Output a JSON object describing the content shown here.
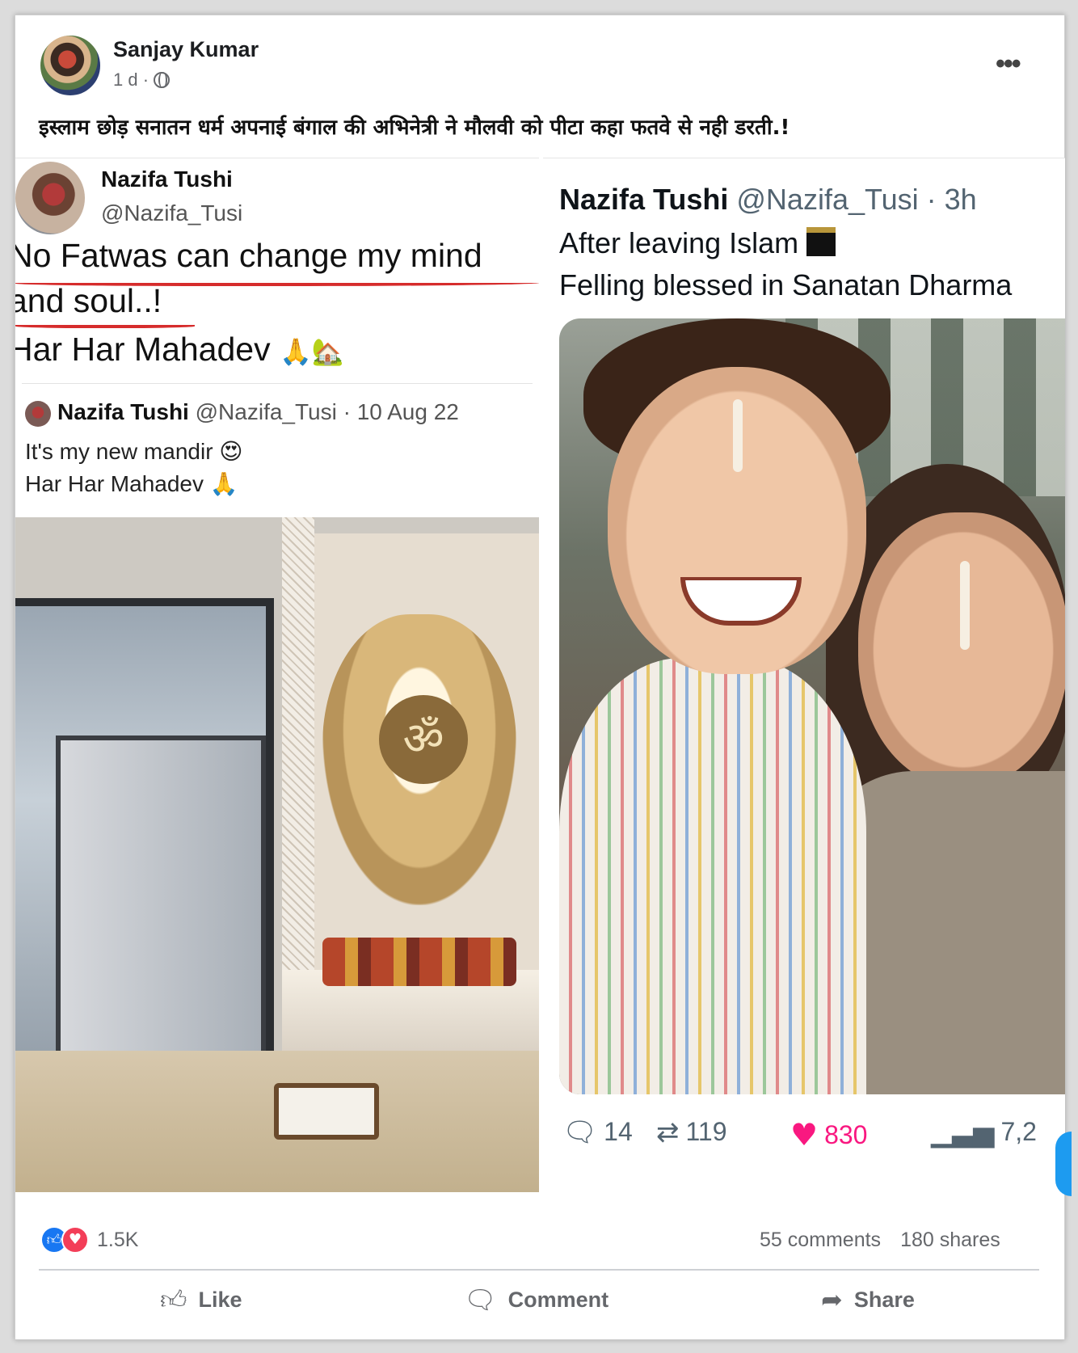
{
  "post": {
    "author": "Sanjay Kumar",
    "time": "1 d ·",
    "more_label": "•••",
    "caption": "इस्लाम छोड़ सनातन धर्म अपनाई बंगाल की अभिनेत्री ने मौलवी को पीटा कहा फतवे से नही डरती.!"
  },
  "left_tweet": {
    "name": "Nazifa Tushi",
    "handle": "@Nazifa_Tusi",
    "line1": "No Fatwas can change my mind",
    "line2": "and soul..!",
    "line3": "Har Har Mahadev",
    "emoji": "🙏🏡",
    "quoted": {
      "name": "Nazifa Tushi",
      "handle_date": "@Nazifa_Tusi · 10 Aug 22",
      "text1": "It's my new mandir 😍",
      "text2": "Har Har Mahadev 🙏",
      "om": "ॐ"
    }
  },
  "right_tweet": {
    "name": "Nazifa Tushi",
    "handle_time": "@Nazifa_Tusi · 3h",
    "line1": "After leaving Islam",
    "line2": "Felling blessed in Sanatan Dharma",
    "actions": {
      "replies": "14",
      "retweets": "119",
      "likes": "830",
      "views": "7,2"
    },
    "icons": {
      "reply": "reply-icon",
      "retweet": "retweet-icon",
      "like": "heart-icon",
      "views": "views-icon"
    }
  },
  "footer": {
    "reaction_count": "1.5K",
    "comments": "55 comments",
    "shares": "180 shares",
    "like_label": "Like",
    "comment_label": "Comment",
    "share_label": "Share"
  },
  "colors": {
    "facebook_blue": "#1877f2",
    "love_red": "#f33e58",
    "twitter_pink": "#f91880",
    "underline_red": "#d62c2c"
  }
}
